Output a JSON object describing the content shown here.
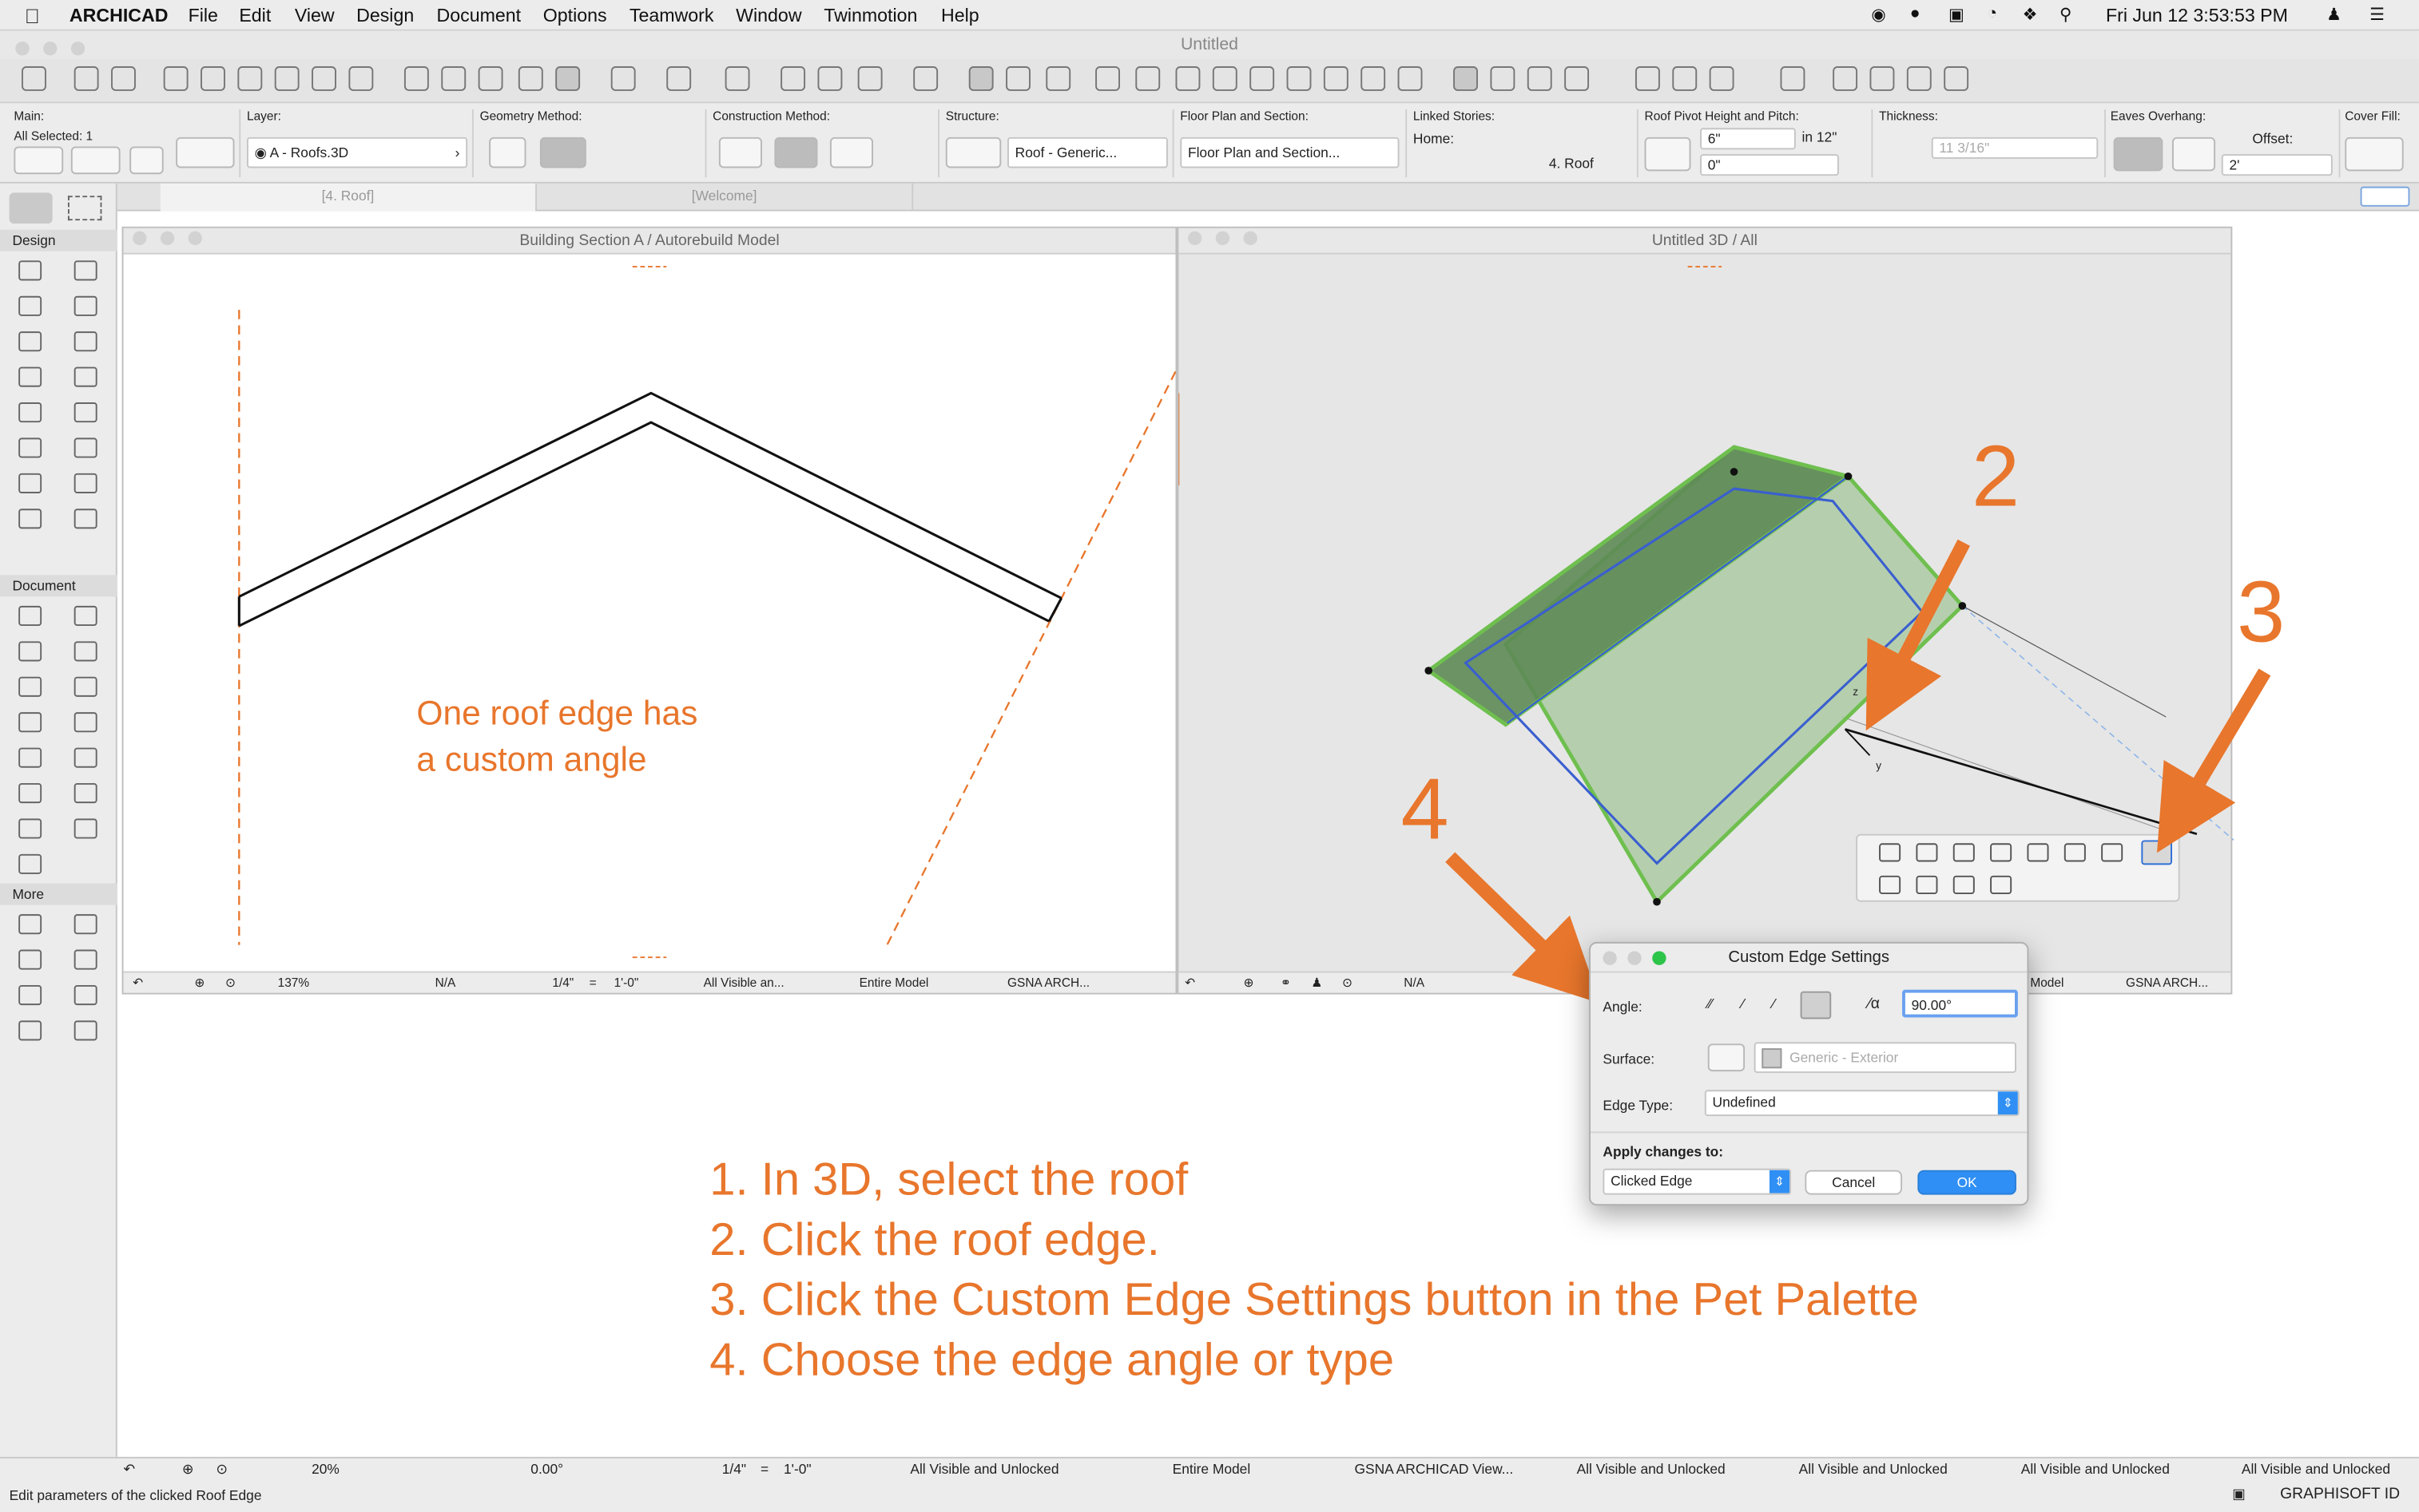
{
  "menubar": {
    "app": "ARCHICAD",
    "items": [
      "File",
      "Edit",
      "View",
      "Design",
      "Document",
      "Options",
      "Teamwork",
      "Window",
      "Twinmotion",
      "Help"
    ],
    "clock": "Fri Jun 12  3:53:53 PM"
  },
  "window_title": "Untitled",
  "infobox": {
    "main_label": "Main:",
    "all_selected": "All Selected: 1",
    "layer_label": "Layer:",
    "layer_value": "A - Roofs.3D",
    "geometry_label": "Geometry Method:",
    "construction_label": "Construction Method:",
    "structure_label": "Structure:",
    "structure_value": "Roof - Generic...",
    "floorplan_label": "Floor Plan and Section:",
    "floorplan_value": "Floor Plan and Section...",
    "linked_label": "Linked Stories:",
    "home_label": "Home:",
    "home_value": "4. Roof",
    "pivot_label": "Roof Pivot Height and Pitch:",
    "pivot_height": "6\"",
    "pitch_unit": "in 12\"",
    "pitch_value": "0\"",
    "thickness_label": "Thickness:",
    "thickness_value": "11 3/16\"",
    "eaves_label": "Eaves Overhang:",
    "offset_label": "Offset:",
    "offset_value": "2'",
    "cover_label": "Cover Fill:"
  },
  "tabs": [
    "[4. Roof]",
    "[Welcome]"
  ],
  "toolbox": {
    "design": "Design",
    "document": "Document",
    "more": "More"
  },
  "section_window": {
    "title": "Building Section A / Autorebuild Model",
    "annotation_line1": "One roof edge has",
    "annotation_line2": "a custom angle",
    "status": {
      "zoom": "137%",
      "angle": "N/A",
      "scale": "1/4\"",
      "eq": "=",
      "scale_val": "1'-0\"",
      "layers": "All Visible an...",
      "model": "Entire Model",
      "penset": "GSNA ARCH..."
    }
  },
  "view3d_window": {
    "title": "Untitled 3D / All",
    "status": {
      "angle": "N/A",
      "model": "Model",
      "penset": "GSNA ARCH..."
    },
    "axis_z": "z",
    "axis_y": "y"
  },
  "callouts": [
    "2",
    "3",
    "4"
  ],
  "dialog": {
    "title": "Custom Edge Settings",
    "angle_label": "Angle:",
    "angle_value": "90.00°",
    "surface_label": "Surface:",
    "surface_value": "Generic - Exterior",
    "edge_type_label": "Edge Type:",
    "edge_type_value": "Undefined",
    "apply_label": "Apply changes to:",
    "apply_value": "Clicked Edge",
    "cancel": "Cancel",
    "ok": "OK"
  },
  "instructions": [
    "1. In 3D, select the roof",
    "2. Click the roof edge.",
    "3. Click the Custom Edge Settings button in the Pet Palette",
    "4. Choose the edge angle or type"
  ],
  "bottombar": {
    "zoom": "20%",
    "angle": "0.00°",
    "scale": "1/4\"",
    "eq": "=",
    "scale_val": "1'-0\"",
    "layers": "All Visible and Unlocked",
    "model": "Entire Model",
    "penset": "GSNA ARCHICAD View...",
    "layers2": "All Visible and Unlocked",
    "layers3": "All Visible and Unlocked",
    "layers4": "All Visible and Unlocked",
    "layers5": "All Visible and Unlocked",
    "hint": "Edit parameters of the clicked Roof Edge",
    "brand": "GRAPHISOFT ID"
  },
  "colors": {
    "accent_orange": "#e8762c",
    "ok_blue": "#2f8ff5",
    "roof_green": "#6fbf4f",
    "edge_blue": "#3a5fcf"
  }
}
